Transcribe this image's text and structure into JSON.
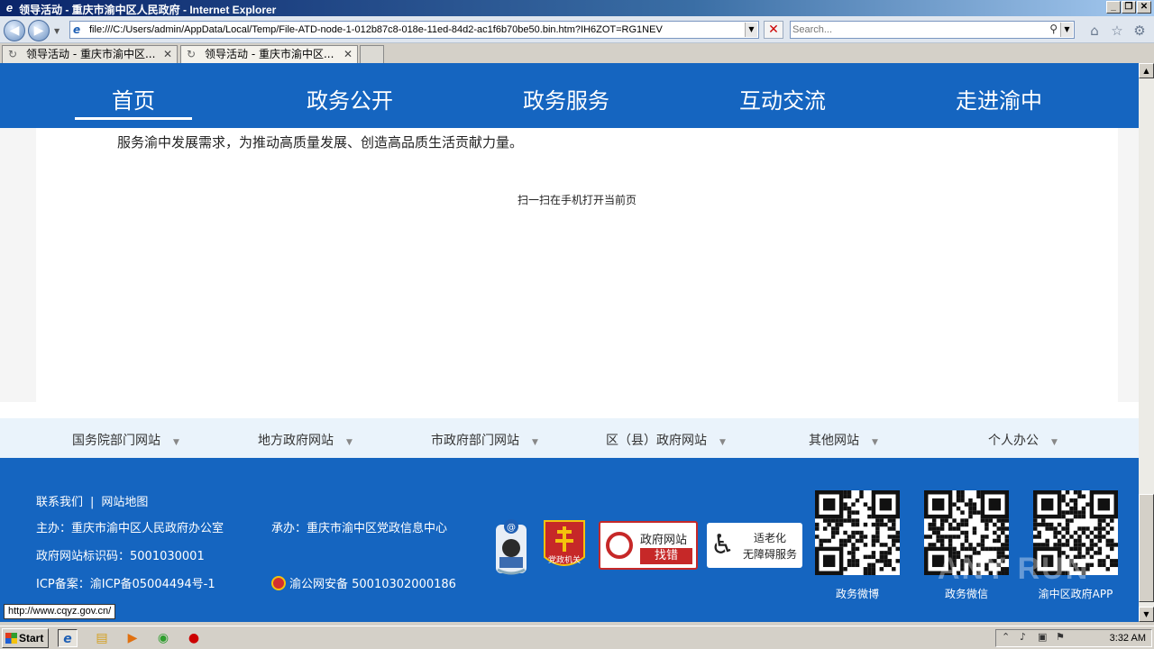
{
  "window": {
    "title": "领导活动 - 重庆市渝中区人民政府 - Internet Explorer"
  },
  "address_bar": {
    "url": "file:///C:/Users/admin/AppData/Local/Temp/File-ATD-node-1-012b87c8-018e-11ed-84d2-ac1f6b70be50.bin.htm?IH6ZOT=RG1NEV",
    "search_placeholder": "Search..."
  },
  "tabs": [
    {
      "label": "领导活动 - 重庆市渝中区..."
    },
    {
      "label": "领导活动 - 重庆市渝中区..."
    }
  ],
  "site_nav": {
    "items": [
      "首页",
      "政务公开",
      "政务服务",
      "互动交流",
      "走进渝中"
    ],
    "active_index": 0
  },
  "content": {
    "paragraph": "服务渝中发展需求，为推动高质量发展、创造高品质生活贡献力量。",
    "scan_text": "扫一扫在手机打开当前页"
  },
  "links_bar": {
    "items": [
      "国务院部门网站",
      "地方政府网站",
      "市政府部门网站",
      "区（县）政府网站",
      "其他网站",
      "个人办公"
    ]
  },
  "footer": {
    "contact": "联系我们",
    "separator": "|",
    "sitemap": "网站地图",
    "sponsor": "主办：重庆市渝中区人民政府办公室",
    "organizer": "承办：重庆市渝中区党政信息中心",
    "site_id": "政府网站标识码：5001030001",
    "icp": "ICP备案：渝ICP备05004494号-1",
    "police": "渝公网安备 50010302000186",
    "badge_party": "党政机关",
    "badge_error_title": "政府网站",
    "badge_error_sub": "找错",
    "badge_access_title": "适老化",
    "badge_access_sub": "无障碍服务",
    "qr_labels": [
      "政务微博",
      "政务微信",
      "渝中区政府APP"
    ]
  },
  "status": {
    "tooltip_url": "http://www.cqyz.gov.cn/"
  },
  "taskbar": {
    "start_label": "Start",
    "clock": "3:32 AM"
  },
  "watermark": "ANY RUN",
  "colors": {
    "brand_blue": "#1565c0",
    "links_bar_bg": "#eaf3fb",
    "badge_red": "#c62828"
  }
}
